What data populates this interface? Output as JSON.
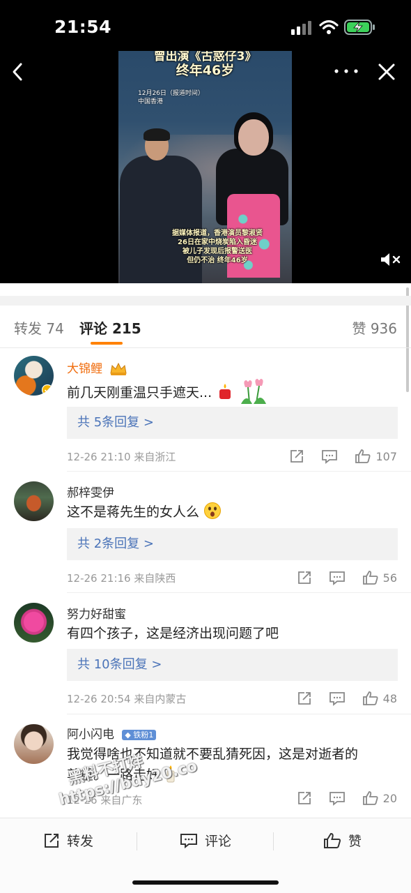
{
  "status_bar": {
    "time": "21:54"
  },
  "video": {
    "headline_1": "曾出演《古惑仔3》",
    "headline_2": "终年46岁",
    "date_line": "12月26日（报道时间）",
    "location": "中国香港",
    "caption_lines": [
      "据媒体报道，香港演员黎淑贤",
      "26日在家中烧炭陷入昏迷",
      "被儿子发现后报警送医",
      "但仍不治 终年46岁"
    ]
  },
  "tabs": {
    "forward": "转发 74",
    "comments": "评论 215",
    "likes": "赞 936"
  },
  "comments": [
    {
      "username": "大锦鲤",
      "text": "前几天刚重温只手遮天...",
      "replies": "共 5条回复 >",
      "meta": "12-26 21:10  来自浙江",
      "like_count": "107"
    },
    {
      "username": "郝梓雯伊",
      "text": "这不是蒋先生的女人么",
      "replies": "共 2条回复 >",
      "meta": "12-26 21:16  来自陕西",
      "like_count": "56"
    },
    {
      "username": "努力好甜蜜",
      "text": "有四个孩子，这是经济出现问题了吧",
      "replies": "共 10条回复 >",
      "meta": "12-26 20:54  来自内蒙古",
      "like_count": "48"
    },
    {
      "username": "阿小闪电",
      "fans_badge": "铁粉1",
      "text_line1": "我觉得啥也不知道就不要乱猜死因，这是对逝者的",
      "text_line2": "尊重。一路走好",
      "meta": "12-26  来自广东",
      "like_count": "20"
    }
  ],
  "bottom_bar": {
    "forward": "转发",
    "comment": "评论",
    "like": "赞"
  },
  "watermark": {
    "line1": "黑料不打烊",
    "line2": "https://bdy20.co"
  },
  "colors": {
    "accent": "#ff8200",
    "link": "#4a73b8",
    "vip_name": "#f06d0e"
  }
}
